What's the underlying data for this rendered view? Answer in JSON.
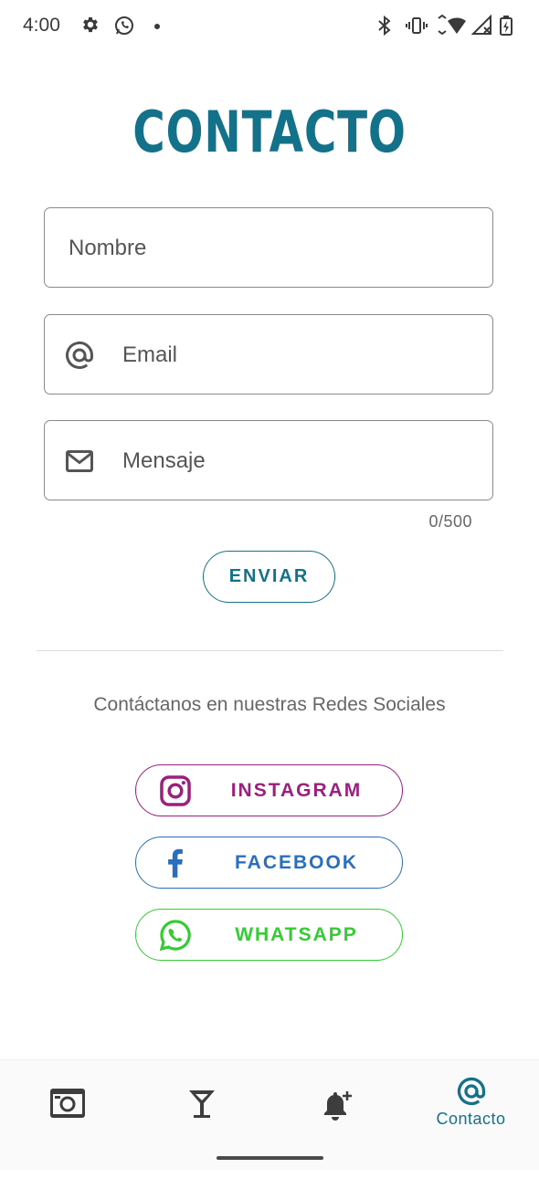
{
  "status_bar": {
    "time": "4:00"
  },
  "page": {
    "title": "CONTACTO"
  },
  "form": {
    "name_placeholder": "Nombre",
    "email_placeholder": "Email",
    "message_placeholder": "Mensaje",
    "char_counter": "0/500",
    "submit_label": "ENVIAR"
  },
  "social": {
    "heading": "Contáctanos en nuestras Redes Sociales",
    "buttons": [
      {
        "label": "INSTAGRAM",
        "icon": "instagram-icon",
        "color": "#9c1f7f"
      },
      {
        "label": "FACEBOOK",
        "icon": "facebook-icon",
        "color": "#2a6fbe"
      },
      {
        "label": "WHATSAPP",
        "icon": "whatsapp-icon",
        "color": "#33cc33"
      }
    ]
  },
  "bottom_nav": {
    "items": [
      {
        "icon": "camera-icon",
        "label": ""
      },
      {
        "icon": "cocktail-icon",
        "label": ""
      },
      {
        "icon": "notification-add-icon",
        "label": ""
      },
      {
        "icon": "at-icon",
        "label": "Contacto",
        "active": true
      }
    ]
  },
  "colors": {
    "accent": "#13728a"
  }
}
